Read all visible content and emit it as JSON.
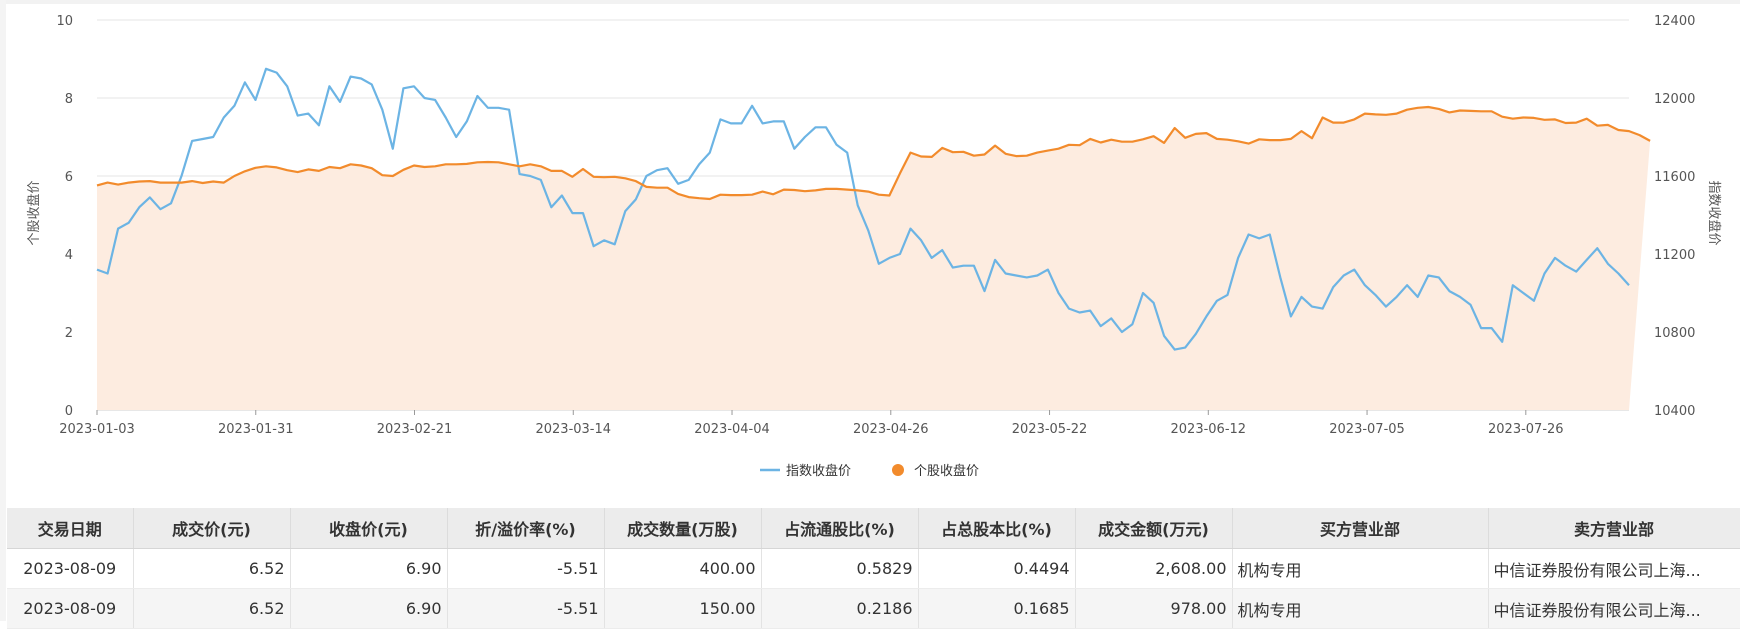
{
  "chart_data": {
    "type": "line",
    "x_ticks": [
      "2023-01-03",
      "2023-01-31",
      "2023-02-21",
      "2023-03-14",
      "2023-04-04",
      "2023-04-26",
      "2023-05-22",
      "2023-06-12",
      "2023-07-05",
      "2023-07-26"
    ],
    "y_left": {
      "label": "个股收盘价",
      "ticks": [
        0,
        2,
        4,
        6,
        8,
        10
      ],
      "range": [
        0,
        10
      ]
    },
    "y_right": {
      "label": "指数收盘价",
      "ticks": [
        10400,
        10800,
        11200,
        11600,
        12000,
        12400
      ],
      "range": [
        10400,
        12400
      ]
    },
    "legend_position": "bottom-center",
    "grid": true,
    "series": [
      {
        "name": "指数收盘价",
        "color": "#6cb4e4",
        "axis": "right",
        "values": [
          11120,
          11100,
          11330,
          11360,
          11440,
          11490,
          11430,
          11460,
          11600,
          11780,
          11790,
          11800,
          11900,
          11960,
          12080,
          11990,
          12150,
          12130,
          12060,
          11910,
          11920,
          11860,
          12060,
          11980,
          12110,
          12100,
          12070,
          11940,
          11740,
          12050,
          12060,
          12000,
          11990,
          11900,
          11800,
          11880,
          12010,
          11950,
          11950,
          11940,
          11610,
          11600,
          11580,
          11440,
          11500,
          11410,
          11410,
          11240,
          11270,
          11250,
          11420,
          11480,
          11600,
          11630,
          11640,
          11560,
          11580,
          11660,
          11720,
          11890,
          11870,
          11870,
          11960,
          11870,
          11880,
          11880,
          11740,
          11800,
          11850,
          11850,
          11760,
          11720,
          11450,
          11320,
          11150,
          11180,
          11200,
          11330,
          11270,
          11180,
          11220,
          11130,
          11140,
          11140,
          11010,
          11170,
          11100,
          11090,
          11080,
          11090,
          11120,
          11000,
          10920,
          10900,
          10910,
          10830,
          10870,
          10800,
          10840,
          11000,
          10950,
          10780,
          10710,
          10720,
          10790,
          10880,
          10960,
          10990,
          11180,
          11300,
          11280,
          11300,
          11080,
          10880,
          10980,
          10930,
          10920,
          11030,
          11090,
          11120,
          11040,
          10990,
          10930,
          10980,
          11040,
          10980,
          11090,
          11080,
          11010,
          10980,
          10940,
          10820,
          10820,
          10750,
          11040,
          11000,
          10960,
          11100,
          11180,
          11140,
          11110,
          11170,
          11230,
          11150,
          11100,
          11040
        ]
      },
      {
        "name": "个股收盘价",
        "color": "#f28b2c",
        "axis": "left",
        "area_fill": "#fdece0",
        "values": [
          5.76,
          5.83,
          5.78,
          5.83,
          5.86,
          5.87,
          5.83,
          5.83,
          5.83,
          5.87,
          5.82,
          5.86,
          5.83,
          6.0,
          6.12,
          6.21,
          6.25,
          6.22,
          6.15,
          6.1,
          6.17,
          6.13,
          6.23,
          6.2,
          6.3,
          6.27,
          6.2,
          6.02,
          6.0,
          6.16,
          6.27,
          6.23,
          6.25,
          6.3,
          6.3,
          6.31,
          6.35,
          6.36,
          6.35,
          6.3,
          6.25,
          6.3,
          6.25,
          6.13,
          6.13,
          5.98,
          6.18,
          5.98,
          5.97,
          5.98,
          5.94,
          5.87,
          5.72,
          5.7,
          5.7,
          5.54,
          5.46,
          5.43,
          5.41,
          5.52,
          5.51,
          5.51,
          5.52,
          5.6,
          5.53,
          5.65,
          5.64,
          5.61,
          5.63,
          5.67,
          5.67,
          5.65,
          5.63,
          5.6,
          5.52,
          5.5,
          6.07,
          6.6,
          6.5,
          6.49,
          6.72,
          6.61,
          6.62,
          6.52,
          6.55,
          6.78,
          6.57,
          6.51,
          6.52,
          6.6,
          6.65,
          6.7,
          6.8,
          6.79,
          6.95,
          6.86,
          6.93,
          6.88,
          6.88,
          6.94,
          7.02,
          6.85,
          7.23,
          6.98,
          7.08,
          7.1,
          6.95,
          6.93,
          6.89,
          6.83,
          6.94,
          6.92,
          6.92,
          6.95,
          7.15,
          6.97,
          7.5,
          7.37,
          7.37,
          7.45,
          7.6,
          7.58,
          7.57,
          7.6,
          7.7,
          7.75,
          7.77,
          7.72,
          7.63,
          7.68,
          7.67,
          7.66,
          7.66,
          7.52,
          7.47,
          7.5,
          7.49,
          7.44,
          7.45,
          7.36,
          7.37,
          7.47,
          7.29,
          7.31,
          7.18,
          7.15,
          7.05,
          6.9
        ]
      }
    ]
  },
  "table": {
    "headers": [
      "交易日期",
      "成交价(元)",
      "收盘价(元)",
      "折/溢价率(%)",
      "成交数量(万股)",
      "占流通股比(%)",
      "占总股本比(%)",
      "成交金额(万元)",
      "买方营业部",
      "卖方营业部"
    ],
    "rows": [
      [
        "2023-08-09",
        "6.52",
        "6.90",
        "-5.51",
        "400.00",
        "0.5829",
        "0.4494",
        "2,608.00",
        "机构专用",
        "中信证券股份有限公司上海..."
      ],
      [
        "2023-08-09",
        "6.52",
        "6.90",
        "-5.51",
        "150.00",
        "0.2186",
        "0.1685",
        "978.00",
        "机构专用",
        "中信证券股份有限公司上海..."
      ]
    ]
  }
}
